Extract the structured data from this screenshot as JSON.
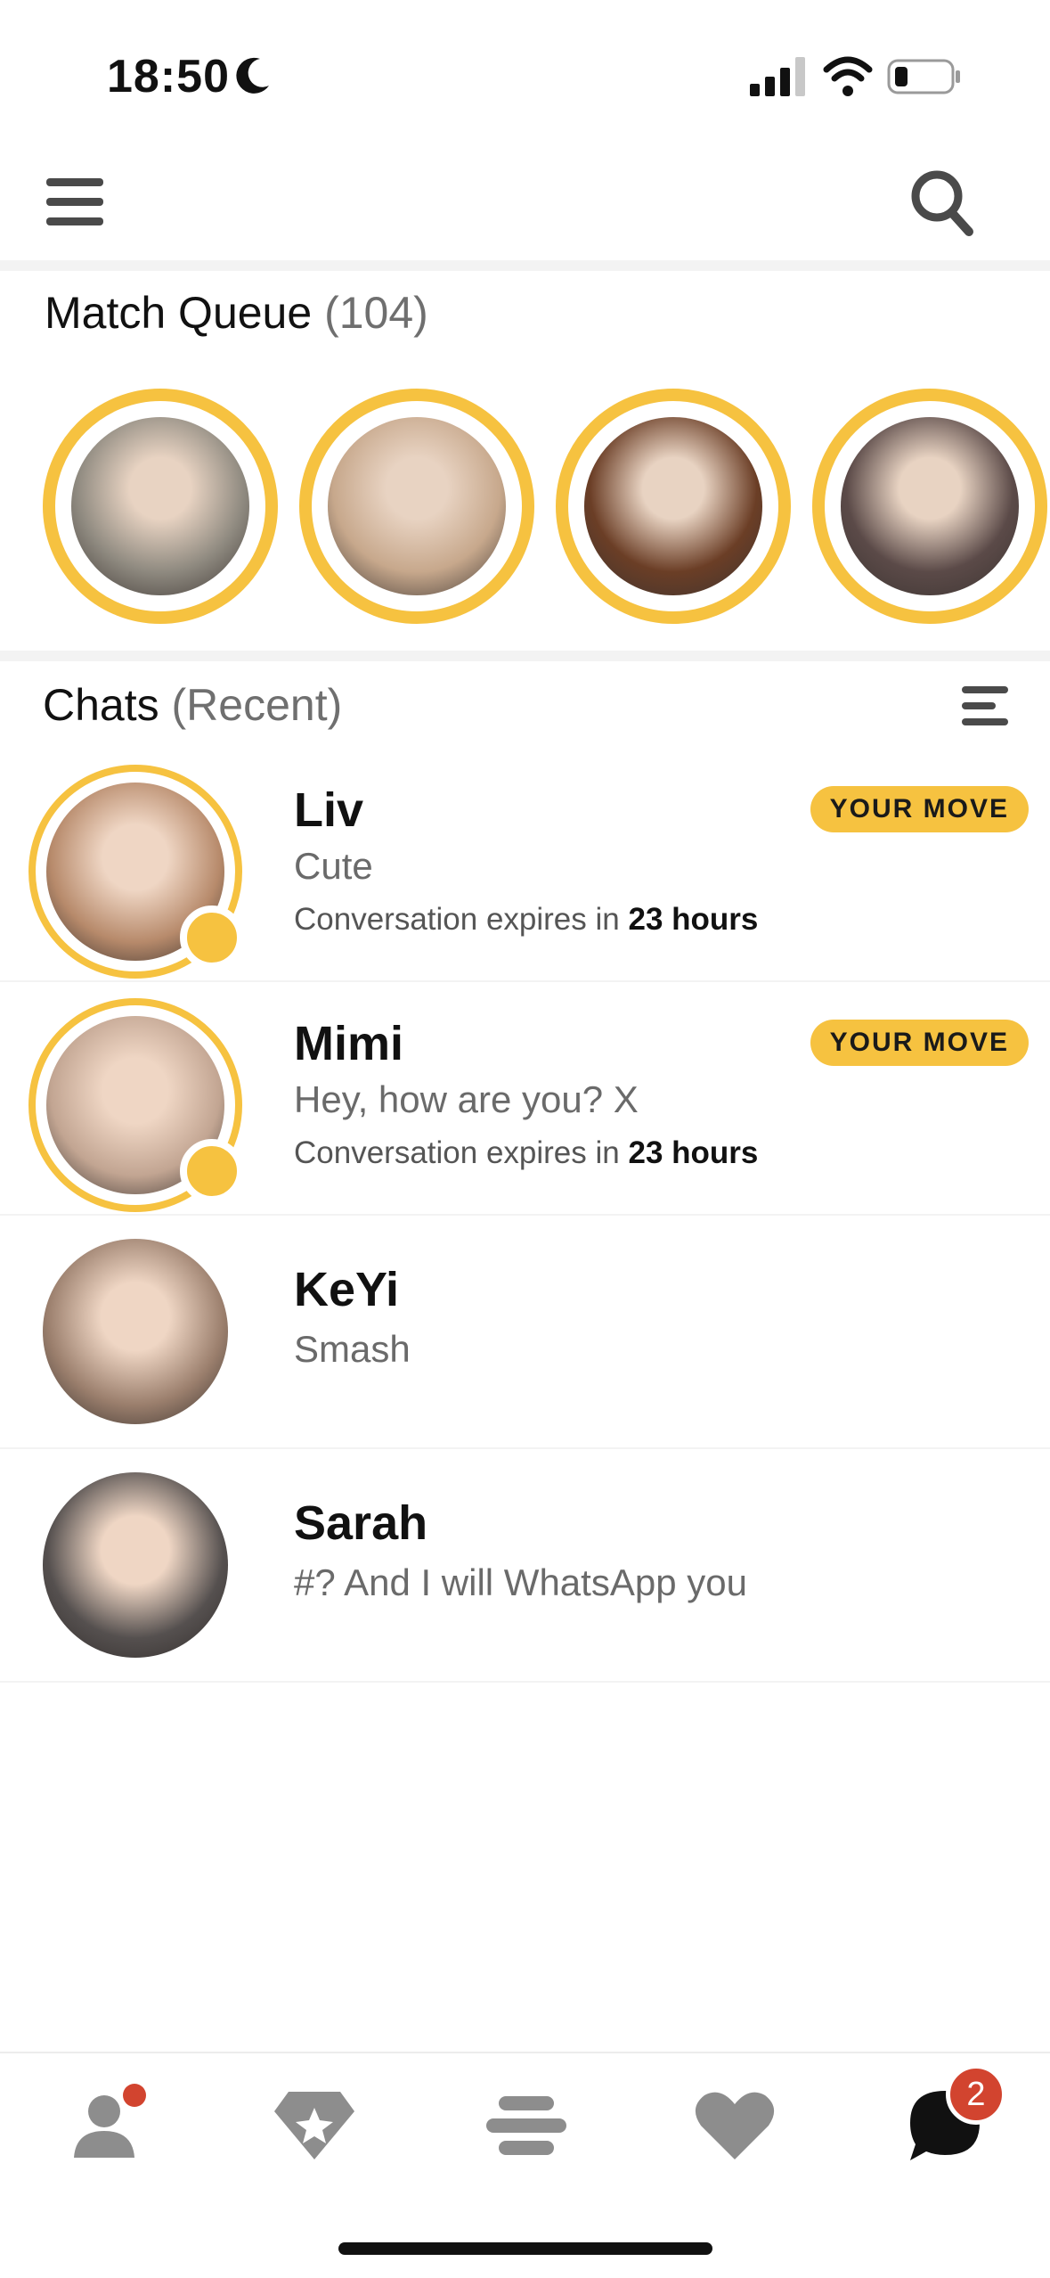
{
  "status_bar": {
    "time": "18:50"
  },
  "header": {
    "menu_icon": "hamburger-icon",
    "search_icon": "search-icon"
  },
  "match_queue": {
    "title": "Match Queue",
    "count": "(104)",
    "profiles": [
      {
        "photo_color": "#8f8a80"
      },
      {
        "photo_color": "#c7a88c"
      },
      {
        "photo_color": "#6b3e26"
      },
      {
        "photo_color": "#5b4a48"
      }
    ]
  },
  "chats": {
    "title": "Chats",
    "subtitle": "(Recent)",
    "items": [
      {
        "name": "Liv",
        "preview": "Cute",
        "expiry_prefix": "Conversation expires in",
        "expiry_value": "23 hours",
        "badge": "YOUR MOVE",
        "photo_color": "#b78a6b"
      },
      {
        "name": "Mimi",
        "preview": "Hey, how are you? X",
        "expiry_prefix": "Conversation expires in",
        "expiry_value": "23 hours",
        "badge": "YOUR MOVE",
        "photo_color": "#c2a592"
      },
      {
        "name": "KeYi",
        "preview": "Smash",
        "photo_color": "#9b7f6d"
      },
      {
        "name": "Sarah",
        "preview": "#? And I will WhatsApp you",
        "photo_color": "#55504f"
      }
    ]
  },
  "bottom_nav": {
    "items": [
      "profile-icon",
      "discover-icon",
      "bumble-hive-icon",
      "likes-icon",
      "chats-icon"
    ],
    "chat_badge": "2"
  },
  "colors": {
    "accent": "#f6c240",
    "alert": "#d2442f",
    "icon_grey": "#8d8d8d"
  }
}
